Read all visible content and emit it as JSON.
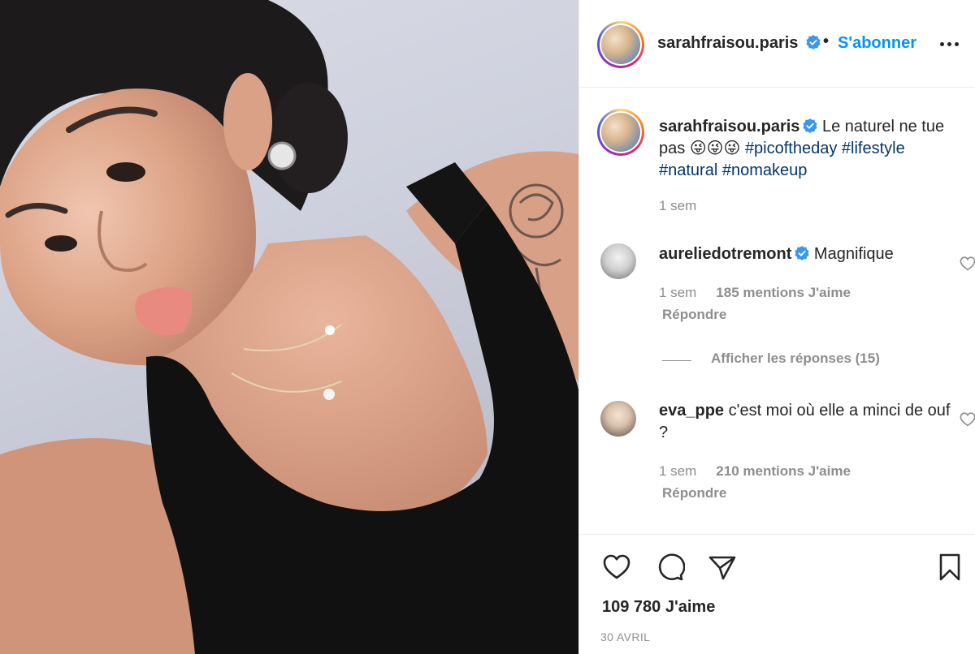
{
  "post": {
    "author": "sarahfraisou.paris",
    "follow_label": "S'abonner",
    "separator": "•",
    "caption": {
      "username": "sarahfraisou.paris",
      "text": "Le naturel ne tue pas",
      "emojis": "😜😜😜",
      "hashtags": [
        "#picoftheday",
        "#lifestyle",
        "#natural",
        "#nomakeup"
      ],
      "time": "1 sem"
    },
    "comments": [
      {
        "username": "aureliedotremont",
        "verified": true,
        "text": "Magnifique",
        "time": "1 sem",
        "likes": "185 mentions J'aime",
        "reply_label": "Répondre",
        "view_replies": "Afficher les réponses (15)"
      },
      {
        "username": "eva_ppe",
        "verified": false,
        "text": "c'est moi où elle a minci de ouf ?",
        "time": "1 sem",
        "likes": "210 mentions J'aime",
        "reply_label": "Répondre"
      }
    ],
    "likes_count": "109 780 J'aime",
    "date": "30 AVRIL"
  },
  "colors": {
    "accent": "#0095f6",
    "verified": "#3897f0",
    "hashtag": "#00376b",
    "muted": "#8e8e8e",
    "text": "#262626"
  },
  "icons": {
    "more": "more-horizontal-icon",
    "like": "heart-icon",
    "comment": "comment-bubble-icon",
    "share": "paper-plane-icon",
    "save": "bookmark-icon",
    "verified": "verified-badge-icon"
  }
}
